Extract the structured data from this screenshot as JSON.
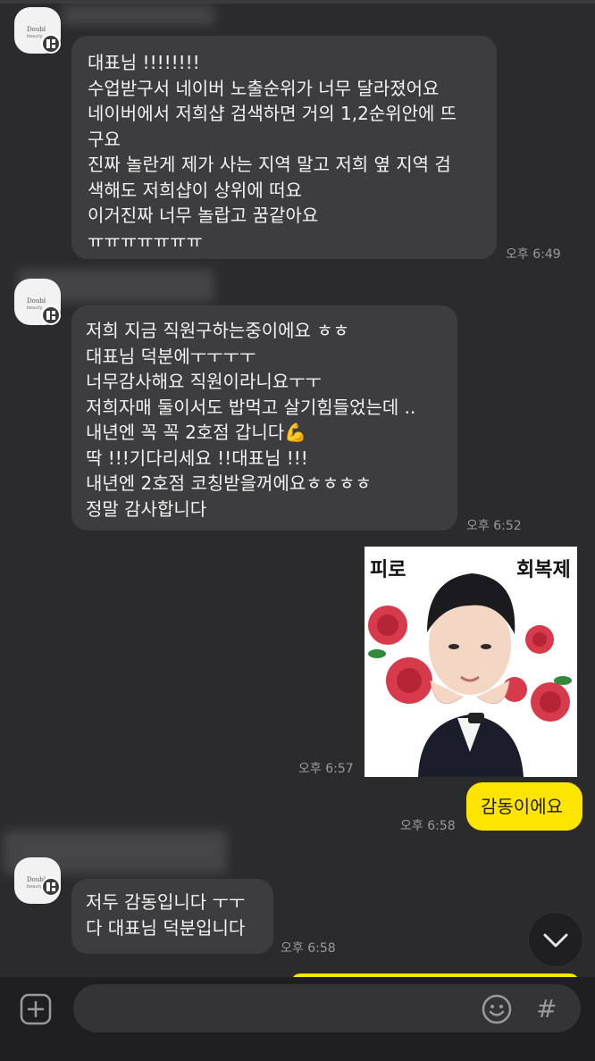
{
  "colors": {
    "background": "#2b2b2d",
    "incoming_bubble": "#3d3d40",
    "outgoing_bubble": "#fee500",
    "time": "#9a9a9d"
  },
  "messages": [
    {
      "lines": [
        "대표님 !!!!!!!!",
        "수업받구서 네이버 노출순위가 너무 달라졌어요",
        "네이버에서 저희샵 검색하면 거의 1,2순위안에 뜨",
        "구요",
        "진짜 놀란게 제가 사는 지역 말고 저희 옆 지역 검",
        "색해도 저희샵이 상위에 떠요",
        "이거진짜 너무 놀랍고 꿈같아요",
        "ㅠㅠㅠㅠㅠㅠㅠ"
      ],
      "time": "오후 6:49"
    },
    {
      "lines": [
        "저희 지금 직원구하는중이에요 ㅎㅎ",
        "대표님 덕분에ㅜㅜㅜㅜ",
        "너무감사해요 직원이라니요ㅜㅜ",
        "저희자매 둘이서도 밥먹고 살기힘들었는데 ..",
        "내년엔 꼭 꼭 2호점 갑니다💪",
        "딱 !!!기다리세요 !!대표님 !!!",
        "내년엔 2호점 코칭받을꺼에요ㅎㅎㅎㅎ",
        "정말 감사합니다"
      ],
      "time": "오후 6:52"
    },
    {
      "lines": [
        "저두 감동입니다 ㅜㅜ",
        "다 대표님 덕분입니다"
      ],
      "time": "오후 6:58"
    }
  ],
  "sticker": {
    "label_left": "피로",
    "label_right": "회복제",
    "time": "오후 6:57"
  },
  "my_message": {
    "text": "감동이에요",
    "time": "오후 6:58"
  },
  "input": {
    "placeholder": "",
    "hash": "#"
  },
  "icons": {
    "plus": "plus-icon",
    "emoji": "emoji-icon",
    "scroll": "chevron-down-icon"
  }
}
